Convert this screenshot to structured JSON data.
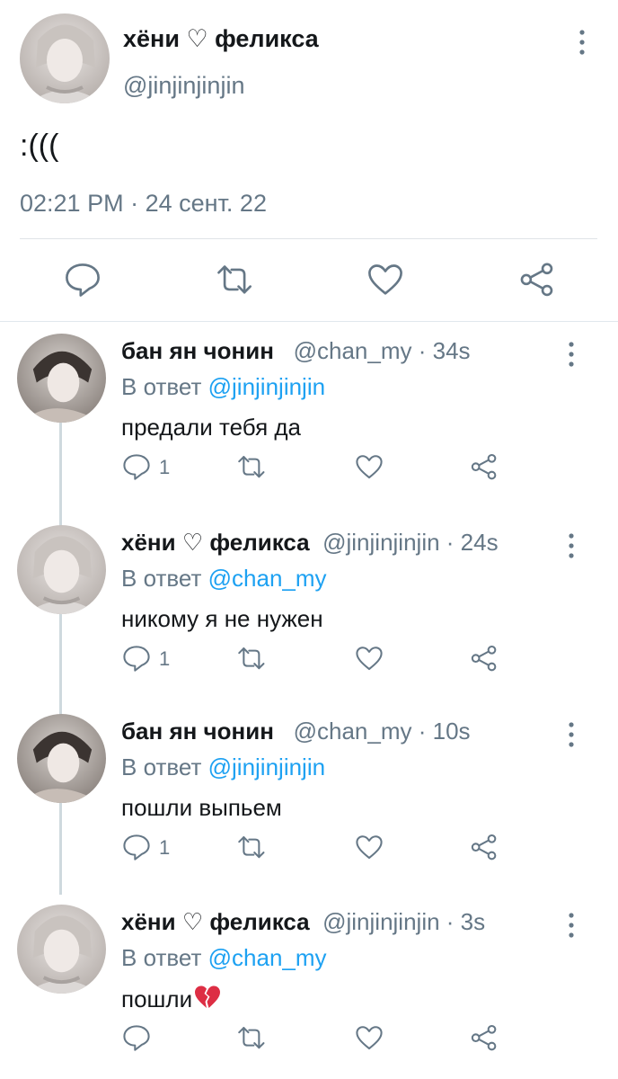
{
  "main_tweet": {
    "name": "хёни ♡ феликса",
    "handle": "@jinjinjinjin",
    "text": ":(((",
    "time": "02:21 PM",
    "date": "24 сент. 22"
  },
  "replies": [
    {
      "name": "бан ян чонин",
      "handle": "@chan_my",
      "age": "34s",
      "reply_prefix": "В ответ",
      "reply_to": "@jinjinjinjin",
      "text": "предали тебя да",
      "reply_count": "1"
    },
    {
      "name": "хёни ♡ феликса",
      "handle": "@jinjinjinjin",
      "age": "24s",
      "reply_prefix": "В ответ",
      "reply_to": "@chan_my",
      "text": "никому я не нужен",
      "reply_count": "1"
    },
    {
      "name": "бан ян чонин",
      "handle": "@chan_my",
      "age": "10s",
      "reply_prefix": "В ответ",
      "reply_to": "@jinjinjinjin",
      "text": "пошли выпьем",
      "reply_count": "1"
    },
    {
      "name": "хёни ♡ феликса",
      "handle": "@jinjinjinjin",
      "age": "3s",
      "reply_prefix": "В ответ",
      "reply_to": "@chan_my",
      "text": "пошли",
      "reply_count": ""
    }
  ],
  "colors": {
    "link": "#1da1f2",
    "secondary": "#657786",
    "icon": "#657786"
  },
  "icons": [
    "more-vertical-icon",
    "reply-icon",
    "retweet-icon",
    "like-icon",
    "share-icon",
    "broken-heart-emoji"
  ]
}
